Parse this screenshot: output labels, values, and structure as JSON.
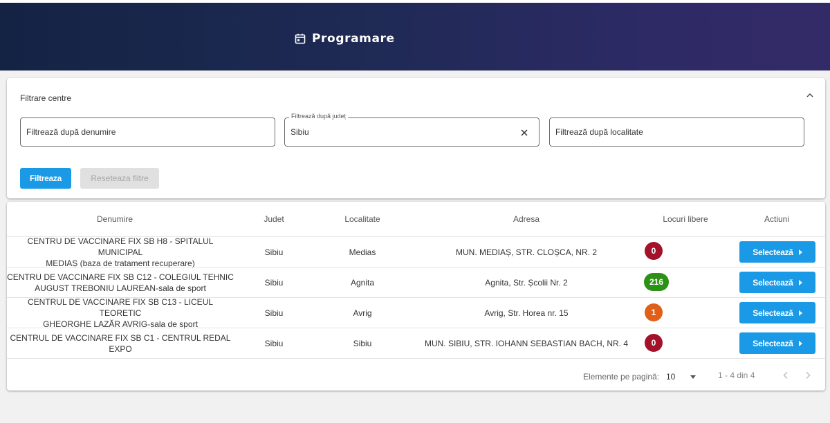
{
  "header": {
    "title": "Programare",
    "icon": "calendar-icon"
  },
  "filter": {
    "title": "Filtrare centre",
    "name_placeholder": "Filtrează după denumire",
    "county_label": "Filtrează după județ",
    "county_value": "Sibiu",
    "locality_placeholder": "Filtrează după localitate",
    "filter_button": "Filtreaza",
    "reset_button": "Reseteaza filtre"
  },
  "table": {
    "columns": [
      "Denumire",
      "Judet",
      "Localitate",
      "Adresa",
      "Locuri libere",
      "Actiuni"
    ],
    "rows": [
      {
        "name_line1": "CENTRU DE VACCINARE FIX SB H8 - SPITALUL MUNICIPAL",
        "name_line2": "MEDIAȘ (baza de tratament recuperare)",
        "county": "Sibiu",
        "locality": "Medias",
        "address": "MUN. MEDIAȘ, STR. CLOȘCA, NR. 2",
        "free": "0",
        "action": "Selectează"
      },
      {
        "name_line1": "CENTRU DE VACCINARE FIX SB C12 - COLEGIUL TEHNIC",
        "name_line2": "AUGUST TREBONIU LAUREAN-sala de sport",
        "county": "Sibiu",
        "locality": "Agnita",
        "address": "Agnita, Str. Școlii Nr. 2",
        "free": "216",
        "action": "Selectează"
      },
      {
        "name_line1": "CENTRUL DE VACCINARE FIX SB C13 - LICEUL TEORETIC",
        "name_line2": "GHEORGHE LAZĂR AVRIG-sala de sport",
        "county": "Sibiu",
        "locality": "Avrig",
        "address": "Avrig, Str. Horea nr. 15",
        "free": "1",
        "action": "Selectează"
      },
      {
        "name_line1": "CENTRUL DE VACCINARE FIX SB C1 - CENTRUL REDAL",
        "name_line2": "EXPO",
        "county": "Sibiu",
        "locality": "Sibiu",
        "address": "MUN. SIBIU, STR. IOHANN SEBASTIAN BACH, NR. 4",
        "free": "0",
        "action": "Selectează"
      }
    ]
  },
  "badge_colors": {
    "zero": "#a3112a",
    "high": "#2b9216",
    "low": "#e0601a"
  },
  "accent_color": "#1a9ae6",
  "pagination": {
    "label": "Elemente pe pagină:",
    "page_size": "10",
    "range": "1 - 4 din 4"
  }
}
